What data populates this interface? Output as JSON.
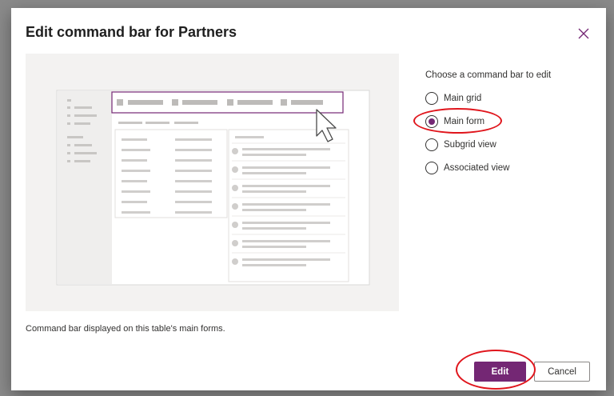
{
  "dialog": {
    "title": "Edit command bar for Partners",
    "close_icon": "close-icon",
    "description": "Command bar displayed on this table's main forms."
  },
  "options": {
    "label": "Choose a command bar to edit",
    "items": [
      {
        "label": "Main grid",
        "selected": false
      },
      {
        "label": "Main form",
        "selected": true
      },
      {
        "label": "Subgrid view",
        "selected": false
      },
      {
        "label": "Associated view",
        "selected": false
      }
    ]
  },
  "buttons": {
    "edit_label": "Edit",
    "cancel_label": "Cancel"
  },
  "colors": {
    "accent": "#742774",
    "highlight": "#e0151c",
    "preview_bg": "#f3f2f1"
  }
}
